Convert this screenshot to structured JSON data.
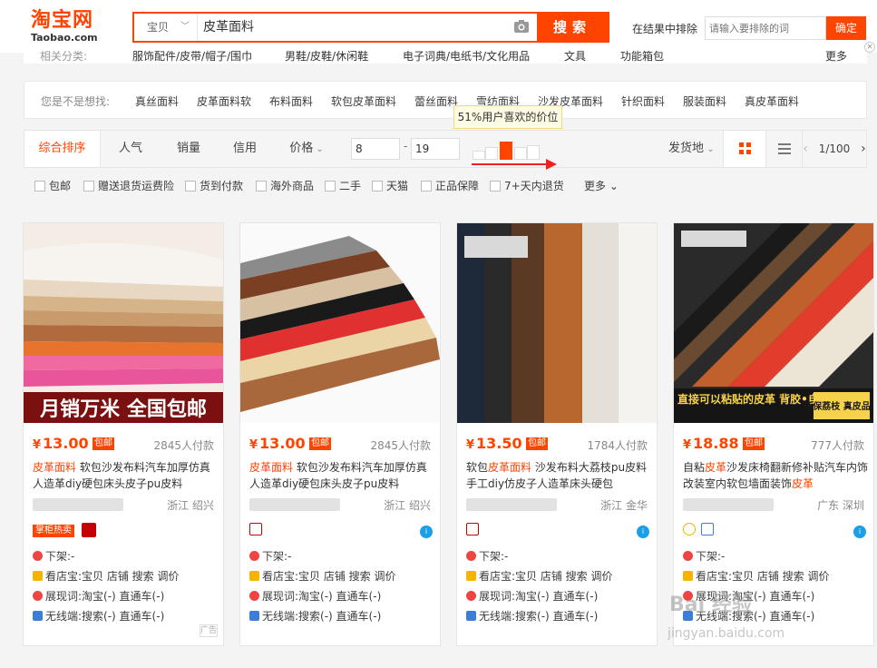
{
  "logo": {
    "cn": "淘宝网",
    "en": "Taobao.com"
  },
  "search": {
    "scope": "宝贝",
    "query": "皮革面料",
    "button": "搜索"
  },
  "exclude": {
    "label": "在结果中排除",
    "placeholder": "请输入要排除的词",
    "button": "确定"
  },
  "related": {
    "label": "相关分类:",
    "items": [
      "服饰配件/皮带/帽子/围巾",
      "男鞋/皮鞋/休闲鞋",
      "电子词典/电纸书/文化用品",
      "文具",
      "功能箱包"
    ],
    "more": "更多"
  },
  "guess": {
    "label": "您是不是想找:",
    "items": [
      "真丝面料",
      "皮革面料软",
      "布料面料",
      "软包皮革面料",
      "蕾丝面料",
      "雪纺面料",
      "沙发皮革面料",
      "针织面料",
      "服装面料",
      "真皮革面料"
    ]
  },
  "sort": {
    "items": [
      "综合排序",
      "人气",
      "销量",
      "信用",
      "价格"
    ],
    "price_min": "8",
    "price_max": "19",
    "tooltip": "51%用户喜欢的价位",
    "ship": "发货地",
    "page": "1/100"
  },
  "filters": [
    "包邮",
    "赠送退货运费险",
    "货到付款",
    "海外商品",
    "二手",
    "天猫",
    "正品保障",
    "7+天内退货"
  ],
  "filters_more": "更多",
  "products": [
    {
      "price": "13.00",
      "badge": "包邮",
      "sold": "2845人付款",
      "title_hl": "皮革面料",
      "title_rest": " 软包沙发布料汽车加厚仿真人造革diy硬包床头皮子pu皮料",
      "loc": "浙江 绍兴",
      "tag": "掌柜热卖",
      "banner": "月销万米 全国包邮"
    },
    {
      "price": "13.00",
      "badge": "包邮",
      "sold": "2845人付款",
      "title_hl": "皮革面料",
      "title_rest": " 软包沙发布料汽车加厚仿真人造革diy硬包床头皮子pu皮料",
      "loc": "浙江 绍兴"
    },
    {
      "price": "13.50",
      "badge": "包邮",
      "sold": "1784人付款",
      "title_pre": "软包",
      "title_hl": "皮革面料",
      "title_rest": " 沙发布料大荔枝pu皮料手工diy仿皮子人造革床头硬包",
      "loc": "浙江 金华"
    },
    {
      "price": "18.88",
      "badge": "包邮",
      "sold": "777人付款",
      "title_pre": "自粘",
      "title_hl": "皮革",
      "title_mid": "沙发床椅翻新修补贴汽车内饰改装室内软包墙面装饰",
      "title_hl2": "皮革",
      "loc": "广东 深圳",
      "banner": "直接可以粘贴的皮革 背胶•自粘皮革",
      "banner2": "环保荔枝 真皮品质"
    }
  ],
  "meta": {
    "shelf": "下架:-",
    "shop": "看店宝:宝贝 店铺 搜索 调价",
    "exposure": "展现词:淘宝(-) 直通车(-)",
    "wireless": "无线端:搜索(-) 直通车(-)"
  },
  "ad_label": "广告",
  "watermark": {
    "line1": "Bai 经验",
    "line2": "jingyan.baidu.com"
  },
  "colors": {
    "accent": "#ff4400",
    "tmall": "#c40000",
    "wangwang": "#1c9fe6"
  }
}
